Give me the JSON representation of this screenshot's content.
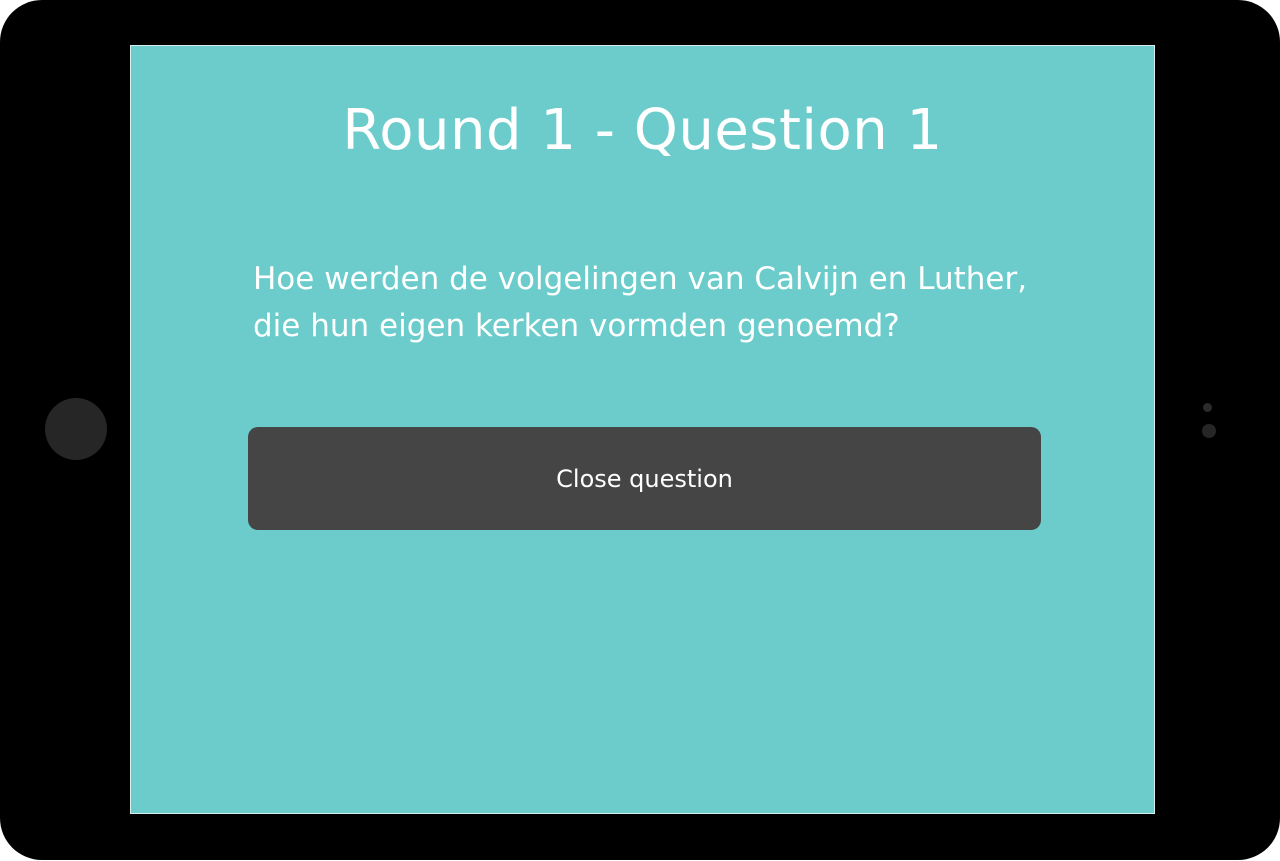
{
  "quiz": {
    "title": "Round 1 - Question 1",
    "question": "Hoe werden de volgelingen van Calvijn en Luther, die hun eigen kerken vormden genoemd?",
    "close_button_label": "Close question"
  },
  "colors": {
    "device_frame": "#000000",
    "screen_background": "#6bcccb",
    "button_background": "#454545",
    "text": "#ffffff"
  }
}
